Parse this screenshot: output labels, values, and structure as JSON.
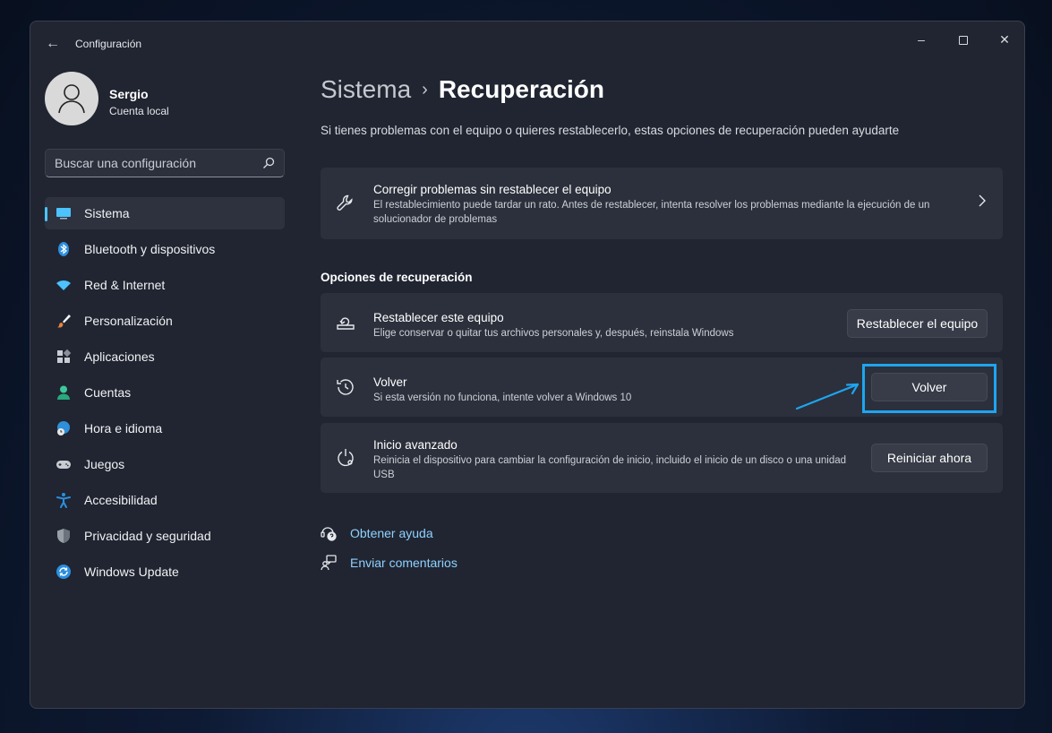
{
  "window": {
    "title": "Configuración"
  },
  "profile": {
    "name": "Sergio",
    "account_type": "Cuenta local"
  },
  "search": {
    "placeholder": "Buscar una configuración"
  },
  "sidebar": {
    "items": [
      {
        "label": "Sistema",
        "icon": "monitor-icon",
        "active": true
      },
      {
        "label": "Bluetooth y dispositivos",
        "icon": "bluetooth-icon"
      },
      {
        "label": "Red & Internet",
        "icon": "wifi-icon"
      },
      {
        "label": "Personalización",
        "icon": "brush-icon"
      },
      {
        "label": "Aplicaciones",
        "icon": "apps-icon"
      },
      {
        "label": "Cuentas",
        "icon": "person-icon"
      },
      {
        "label": "Hora e idioma",
        "icon": "globe-clock-icon"
      },
      {
        "label": "Juegos",
        "icon": "gamepad-icon"
      },
      {
        "label": "Accesibilidad",
        "icon": "accessibility-icon"
      },
      {
        "label": "Privacidad y seguridad",
        "icon": "shield-icon"
      },
      {
        "label": "Windows Update",
        "icon": "update-icon"
      }
    ]
  },
  "main": {
    "breadcrumb": {
      "parent": "Sistema",
      "current": "Recuperación"
    },
    "subtitle": "Si tienes problemas con el equipo o quieres restablecerlo, estas opciones de recuperación pueden ayudarte",
    "troubleshoot": {
      "title": "Corregir problemas sin restablecer el equipo",
      "description": "El restablecimiento puede tardar un rato. Antes de restablecer, intenta resolver los problemas mediante la ejecución de un solucionador de problemas"
    },
    "section_title": "Opciones de recuperación",
    "reset": {
      "title": "Restablecer este equipo",
      "description": "Elige conservar o quitar tus archivos personales y, después, reinstala Windows",
      "button": "Restablecer el equipo"
    },
    "goback": {
      "title": "Volver",
      "description": "Si esta versión no funciona, intente volver a Windows 10",
      "button": "Volver"
    },
    "advanced": {
      "title": "Inicio avanzado",
      "description": "Reinicia el dispositivo para cambiar la configuración de inicio, incluido el inicio de un disco o una unidad USB",
      "button": "Reiniciar ahora"
    },
    "links": {
      "help": "Obtener ayuda",
      "feedback": "Enviar comentarios"
    }
  },
  "colors": {
    "accent": "#4cc2ff",
    "highlight": "#1ea5f0",
    "link": "#8fd1ff"
  }
}
